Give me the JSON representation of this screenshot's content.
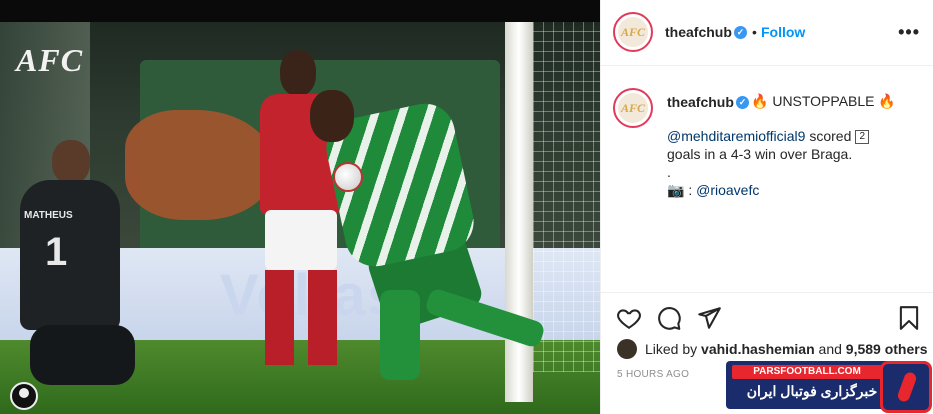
{
  "photo": {
    "logo_text": "AFC",
    "keeper_name": "MATHEUS",
    "keeper_number": "1",
    "board_text": "Voltas"
  },
  "header": {
    "avatar_text": "AFC",
    "username": "theafchub",
    "separator": "•",
    "follow_label": "Follow",
    "more_label": "•••"
  },
  "caption": {
    "avatar_text": "AFC",
    "username": "theafchub",
    "fire": "🔥",
    "headline": "UNSTOPPABLE",
    "mention": "@mehditaremiofficial9",
    "scored": "scored",
    "goals_count": "2",
    "line2": "goals in a 4-3 win over Braga.",
    "line3": ".",
    "camera": "📷",
    "photo_prefix": ":",
    "photo_credit": "@rioavefc"
  },
  "actions": {
    "like_icon": "heart-icon",
    "comment_icon": "comment-icon",
    "share_icon": "share-icon",
    "save_icon": "bookmark-icon"
  },
  "likes": {
    "prefix": "Liked by",
    "user": "vahid.hashemian",
    "conj": "and",
    "others": "9,589 others"
  },
  "timestamp": "5 HOURS AGO",
  "watermark": {
    "top": "PARSFOOTBALL.COM",
    "bottom": "خبرگزاری فوتبال ایران"
  },
  "colors": {
    "follow_blue": "#0095f6",
    "mention_blue": "#00376b",
    "verified_blue": "#3897f0",
    "watermark_red": "#e7262e",
    "watermark_navy": "#1a2c6b"
  }
}
